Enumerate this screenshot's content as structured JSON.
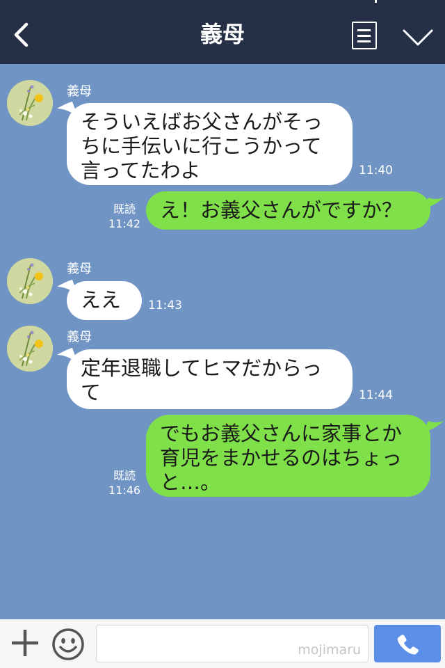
{
  "header": {
    "title": "義母"
  },
  "messages": [
    {
      "sender": "義母",
      "text": "そういえばお父さんがそっ\nちに手伝いに行こうかって\n言ってたわよ",
      "time": "11:40"
    },
    {
      "text": "え！お義父さんがですか？",
      "read": "既読",
      "time": "11:42"
    },
    {
      "sender": "義母",
      "text": "ええ",
      "time": "11:43"
    },
    {
      "sender": "義母",
      "text": "定年退職してヒマだからっ\nて",
      "time": "11:44"
    },
    {
      "text": "でもお義父さんに家事とか\n育児をまかせるのはちょっ\nと…。",
      "read": "既読",
      "time": "11:46"
    }
  ],
  "footer": {
    "watermark": "mojimaru"
  },
  "colors": {
    "header": "#253047",
    "background": "#7094c4",
    "outgoing_bubble": "#80e04a",
    "incoming_bubble": "#ffffff",
    "call_button": "#5b8ee6"
  },
  "icons": [
    "back-icon",
    "menu-icon",
    "chevron-down-icon",
    "plus-icon",
    "smile-icon",
    "phone-icon"
  ]
}
